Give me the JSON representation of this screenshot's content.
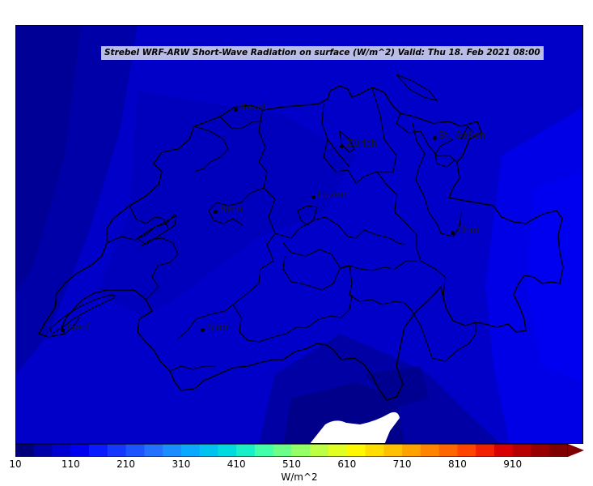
{
  "title": "Strebel WRF-ARW Short-Wave Radiation on surface (W/m^2)   Valid: Thu 18. Feb 2021 08:00",
  "cities": [
    {
      "id": "basel",
      "name": "Basel"
    },
    {
      "id": "zurich",
      "name": "Zürich"
    },
    {
      "id": "st-gallen",
      "name": "St. Gallen"
    },
    {
      "id": "luzern",
      "name": "Luzern"
    },
    {
      "id": "bern",
      "name": "Bern"
    },
    {
      "id": "chur",
      "name": "Chur"
    },
    {
      "id": "genf",
      "name": "Genf"
    },
    {
      "id": "sion",
      "name": "Sion"
    }
  ],
  "colorbar": {
    "unit": "W/m^2",
    "ticks": [
      "10",
      "110",
      "210",
      "310",
      "410",
      "510",
      "610",
      "710",
      "810",
      "910"
    ],
    "range": [
      10,
      1010
    ],
    "extend": "max",
    "colors": [
      "#00007a",
      "#0000a8",
      "#0000d0",
      "#0000f0",
      "#0a1cff",
      "#1438ff",
      "#1c55ff",
      "#2372ff",
      "#1a8eff",
      "#0aa8ff",
      "#00c2f0",
      "#00dbe0",
      "#1af0c8",
      "#44ffaa",
      "#6cff88",
      "#94ff66",
      "#bcff44",
      "#e2ff22",
      "#fff800",
      "#ffdd00",
      "#ffc000",
      "#ffa200",
      "#ff8400",
      "#ff6600",
      "#ff4400",
      "#f02000",
      "#d80000",
      "#b80000",
      "#980000",
      "#800000"
    ],
    "extend_color": "#800000"
  },
  "field_colors": {
    "deep": "#000085",
    "mid": "#0000b4",
    "main": "#0000c8",
    "bright": "#0000e6",
    "hole": "#ffffff"
  }
}
